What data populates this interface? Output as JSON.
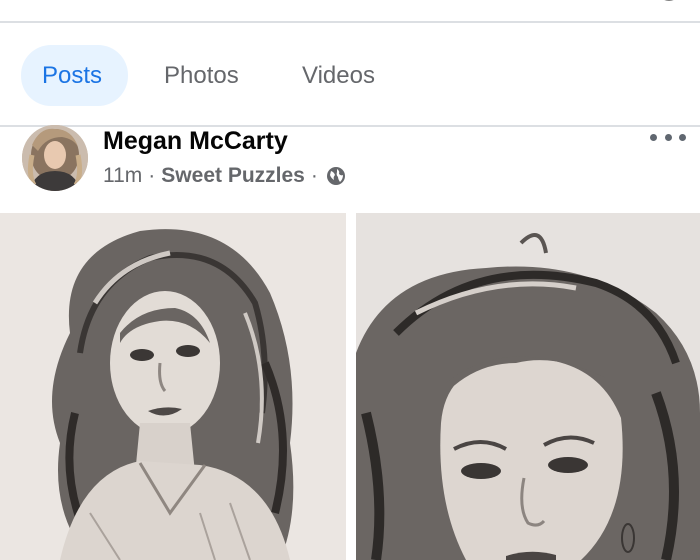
{
  "tabs": [
    {
      "label": "Posts",
      "active": true
    },
    {
      "label": "Photos",
      "active": false
    },
    {
      "label": "Videos",
      "active": false
    }
  ],
  "post": {
    "author": "Megan McCarty",
    "time": "11m",
    "separator": "·",
    "group": "Sweet Puzzles",
    "audience_icon": "globe-icon",
    "more_icon": "more-options-icon",
    "images": [
      {
        "name": "photo-sketch-woman-left"
      },
      {
        "name": "photo-sketch-woman-right"
      }
    ]
  },
  "colors": {
    "accent": "#1b74e4",
    "accent_bg": "#e7f3ff",
    "secondary_text": "#65676b",
    "divider": "#dcdfe3"
  }
}
